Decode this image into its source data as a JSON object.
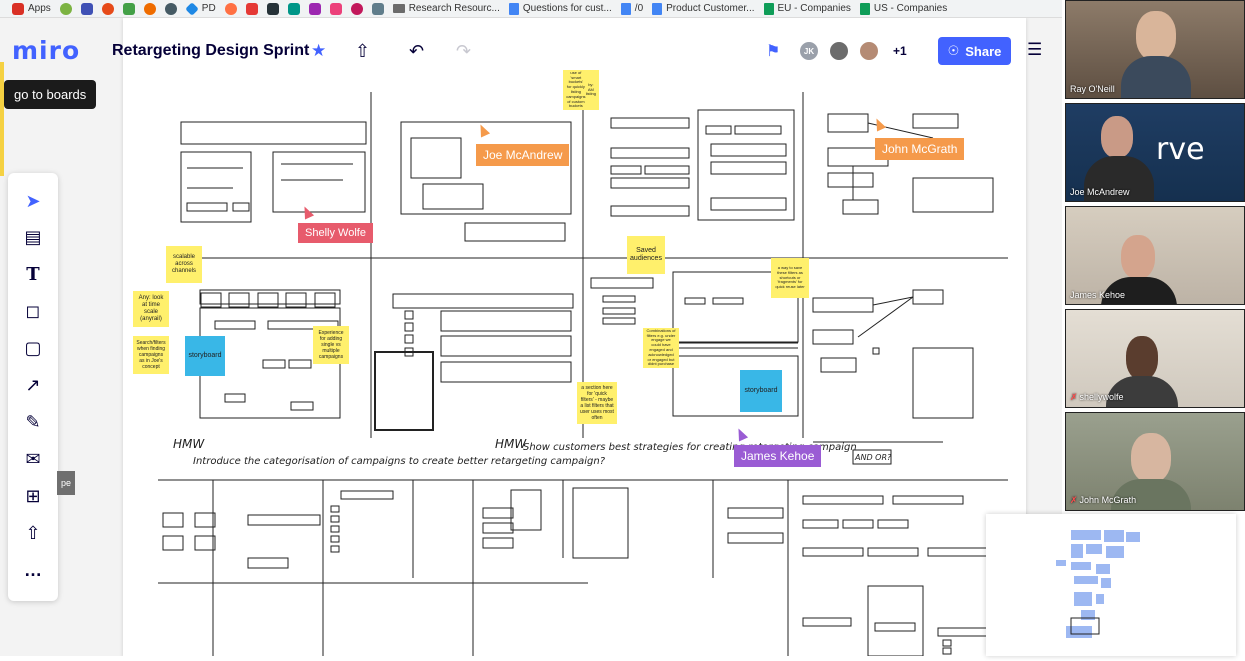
{
  "bookmarks": [
    {
      "label": "Apps",
      "color": "#d93025"
    },
    {
      "label": "",
      "color": "#7cb342"
    },
    {
      "label": "",
      "color": "#3f51b5"
    },
    {
      "label": "",
      "color": "#e64a19"
    },
    {
      "label": "",
      "color": "#43a047"
    },
    {
      "label": "",
      "color": "#ef6c00"
    },
    {
      "label": "",
      "color": "#455a64"
    },
    {
      "label": "PD",
      "color": "#1e88e5"
    },
    {
      "label": "",
      "color": "#ff7043"
    },
    {
      "label": "",
      "color": "#e53935"
    },
    {
      "label": "",
      "color": "#263238"
    },
    {
      "label": "",
      "color": "#009688"
    },
    {
      "label": "",
      "color": "#9c27b0"
    },
    {
      "label": "",
      "color": "#ec407a"
    },
    {
      "label": "",
      "color": "#c2185b"
    },
    {
      "label": "",
      "color": "#607d8b"
    }
  ],
  "bookmark_links": [
    {
      "label": "Research Resourc...",
      "type": "folder"
    },
    {
      "label": "Questions for cust...",
      "type": "doc"
    },
    {
      "label": "/0",
      "type": "doc"
    },
    {
      "label": "Product Customer...",
      "type": "doc"
    },
    {
      "label": "EU - Companies",
      "type": "sheet"
    },
    {
      "label": "US - Companies",
      "type": "sheet"
    }
  ],
  "app": {
    "logo": "miro",
    "board_title": "Retargeting Design Sprint",
    "tooltip": "go to boards",
    "share_label": "Share",
    "presence_initials": "JK",
    "presence_extra": "+1",
    "left_hint": "pe"
  },
  "sketch": {
    "heading_left": "Introduce the categorisation of campaigns to create better retargeting campaign?",
    "heading_left_prefix": "HMW",
    "heading_right": "Show customers best strategies for creating retargeting campaign",
    "heading_right_prefix": "HMW",
    "and_or": "AND OR?"
  },
  "cursors": [
    {
      "name": "Shelly Wolfe",
      "tag": "tag-red"
    },
    {
      "name": "Joe McAndrew",
      "tag": "tag-orange"
    },
    {
      "name": "John McGrath",
      "tag": "tag-orange"
    },
    {
      "name": "James Kehoe",
      "tag": "tag-purple"
    }
  ],
  "stickies": {
    "scalable": "scalable across channels",
    "timescale": "Any: look at time scale (anyrail)",
    "search": "Search/filters when finding campaigns as in Joe's concept",
    "storyboard1": "storyboard",
    "experience": "Experience for adding single vs multiple campaigns",
    "saved": "Saved audiences",
    "smart": "use of 'smart buckets' for quickly listing campaigns of custom buckets",
    "smart_by": "by: AM listing",
    "combinations": "Combinations of filters e.g. under engage we could have engaged and acknowledged or engaged but didnt purchase",
    "quickfilters": "a section here for 'quick filters' - maybe a list filters that user uses most often",
    "fragments": "a way to save these filters as shortcuts or 'fragments' for quick reuse later",
    "storyboard2": "storyboard"
  },
  "participants": [
    {
      "name": "Ray O'Neill",
      "muted": false,
      "bg": "#7a6a5a"
    },
    {
      "name": "Joe McAndrew",
      "muted": false,
      "bg": "#1f3d63"
    },
    {
      "name": "James Kehoe",
      "muted": false,
      "bg": "#c9bfb2"
    },
    {
      "name": "shellywolfe",
      "muted": true,
      "bg": "#d8d2c7"
    },
    {
      "name": "John McGrath",
      "muted": true,
      "bg": "#8a8f80"
    }
  ]
}
